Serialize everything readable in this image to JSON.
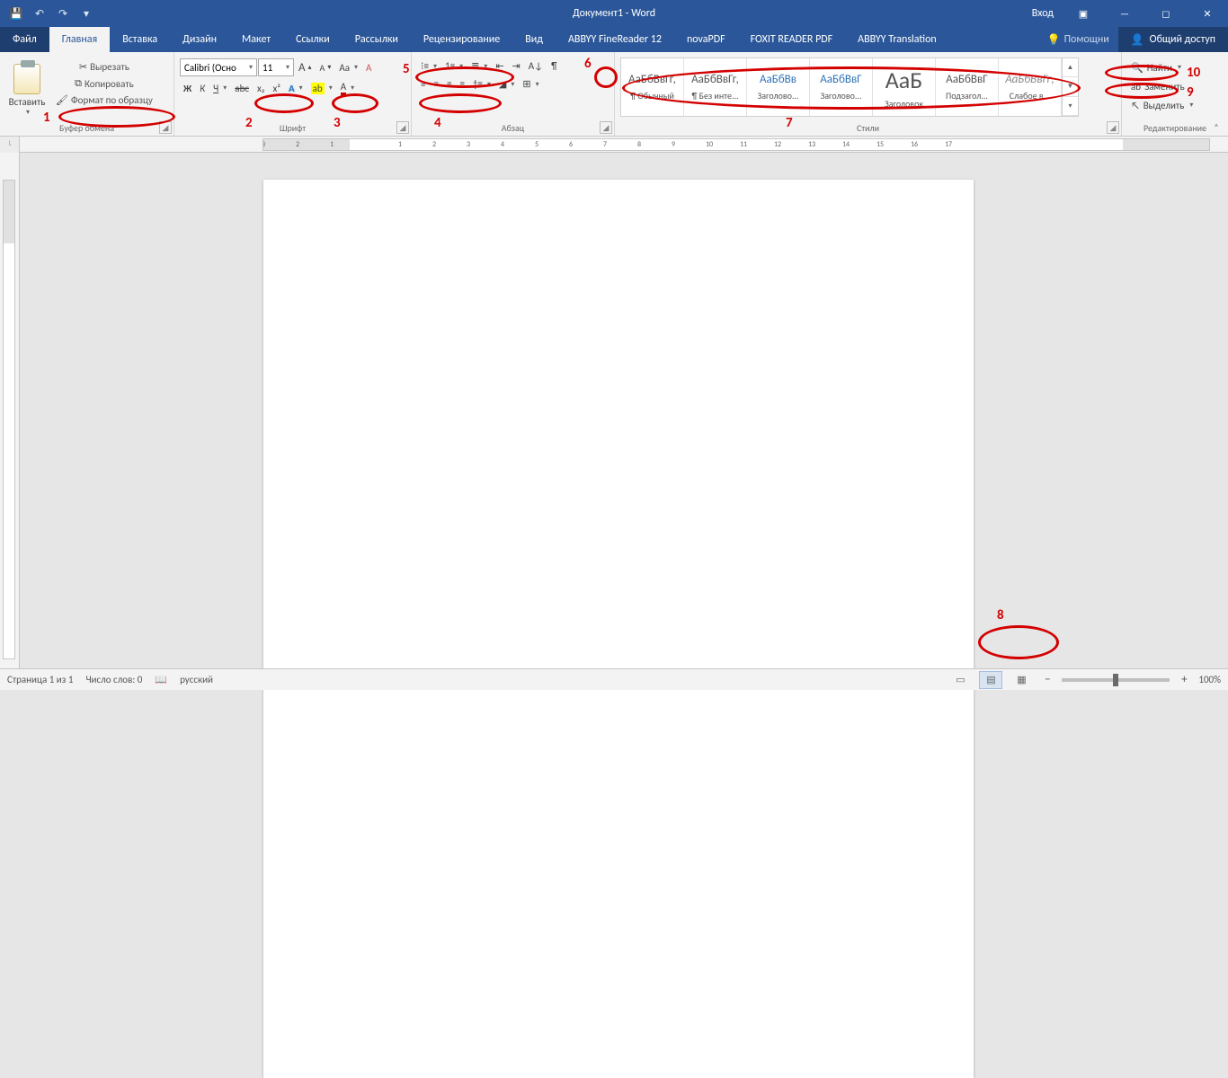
{
  "titlebar": {
    "title": "Документ1 - Word",
    "account": "Вход"
  },
  "tabs": {
    "file": "Файл",
    "items": [
      "Главная",
      "Вставка",
      "Дизайн",
      "Макет",
      "Ссылки",
      "Рассылки",
      "Рецензирование",
      "Вид",
      "ABBYY FineReader 12",
      "novaPDF",
      "FOXIT READER PDF",
      "ABBYY Translation"
    ],
    "active": 0,
    "help": "Помощни",
    "share": "Общий доступ"
  },
  "ribbon": {
    "clipboard": {
      "paste": "Вставить",
      "cut": "Вырезать",
      "copy": "Копировать",
      "format_painter": "Формат по образцу",
      "label": "Буфер обмена"
    },
    "font": {
      "name": "Calibri (Осно",
      "size": "11",
      "bold": "Ж",
      "italic": "К",
      "underline": "Ч",
      "strike": "abc",
      "sub": "x₂",
      "sup": "x²",
      "grow": "A",
      "shrink": "A",
      "case": "Aa",
      "clear": "A",
      "texteff": "A",
      "highlight": "ab",
      "color": "A",
      "label": "Шрифт"
    },
    "paragraph": {
      "label": "Абзац"
    },
    "styles": {
      "label": "Стили",
      "items": [
        {
          "preview": "АаБбВвГг,",
          "name": "¶ Обычный"
        },
        {
          "preview": "АаБбВвГг,",
          "name": "¶ Без инте..."
        },
        {
          "preview": "АаБбВв",
          "name": "Заголово..."
        },
        {
          "preview": "АаБбВвГ",
          "name": "Заголово..."
        },
        {
          "preview": "АаБ",
          "name": "Заголовок"
        },
        {
          "preview": "АаБбВвГ",
          "name": "Подзагол..."
        },
        {
          "preview": "АаБбВвГг,",
          "name": "Слабое в..."
        }
      ]
    },
    "editing": {
      "find": "Найти",
      "replace": "Заменить",
      "select": "Выделить",
      "label": "Редактирование"
    }
  },
  "ruler": {
    "numbers": [
      "3",
      "2",
      "1",
      "",
      "1",
      "2",
      "3",
      "4",
      "5",
      "6",
      "7",
      "8",
      "9",
      "10",
      "11",
      "12",
      "13",
      "14",
      "15",
      "16",
      "17"
    ]
  },
  "status": {
    "page": "Страница 1 из 1",
    "words": "Число слов: 0",
    "lang": "русский",
    "zoom": "100%"
  },
  "annotations": {
    "n1": "1",
    "n2": "2",
    "n3": "3",
    "n4": "4",
    "n5": "5",
    "n6": "6",
    "n7": "7",
    "n8": "8",
    "n9": "9",
    "n10": "10"
  }
}
